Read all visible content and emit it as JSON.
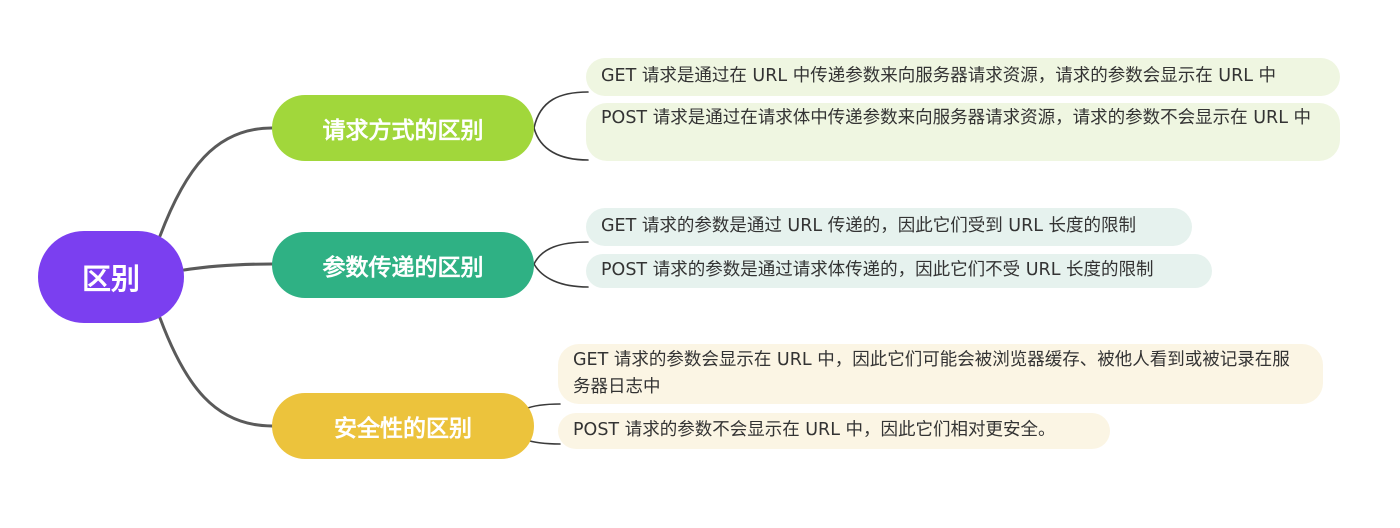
{
  "diagram": {
    "root": {
      "label": "区别",
      "color": "#7b3ff0"
    },
    "branches": [
      {
        "label": "请求方式的区别",
        "color": "#a1d73b",
        "leaf_color": "#eff6e1",
        "items": [
          "GET 请求是通过在 URL 中传递参数来向服务器请求资源，请求的参数会显示在 URL 中",
          "POST 请求是通过在请求体中传递参数来向服务器请求资源，请求的参数不会显示在 URL 中"
        ]
      },
      {
        "label": "参数传递的区别",
        "color": "#2fb184",
        "leaf_color": "#e6f2ee",
        "items": [
          "GET 请求的参数是通过 URL 传递的，因此它们受到 URL 长度的限制",
          "POST 请求的参数是通过请求体传递的，因此它们不受 URL 长度的限制"
        ]
      },
      {
        "label": "安全性的区别",
        "color": "#ecc33c",
        "leaf_color": "#fbf5e4",
        "items": [
          "GET 请求的参数会显示在 URL 中，因此它们可能会被浏览器缓存、被他人看到或被记录在服务器日志中",
          "POST 请求的参数不会显示在 URL 中，因此它们相对更安全。"
        ]
      }
    ]
  }
}
